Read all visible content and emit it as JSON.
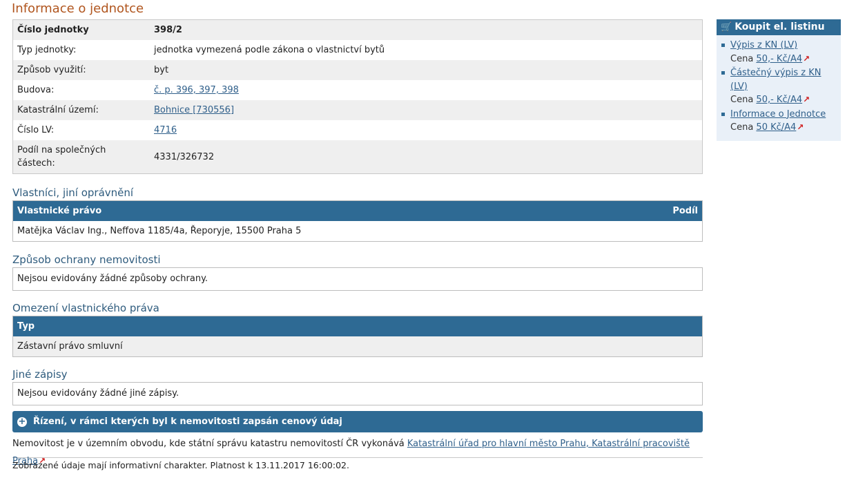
{
  "page_title": "Informace o jednotce",
  "unit_info": {
    "rows": [
      {
        "label": "Číslo jednotky",
        "value": "398/2"
      },
      {
        "label": "Typ jednotky:",
        "value": "jednotka vymezená podle zákona o vlastnictví bytů"
      },
      {
        "label": "Způsob využití:",
        "value": "byt"
      },
      {
        "label": "Budova:",
        "value": "č. p. 396, 397, 398"
      },
      {
        "label": "Katastrální území:",
        "value": "Bohnice [730556]"
      },
      {
        "label": "Číslo LV:",
        "value": "4716"
      },
      {
        "label": "Podíl na společných částech:",
        "value": "4331/326732"
      }
    ]
  },
  "owners": {
    "title": "Vlastníci, jiní oprávnění",
    "col_right": "Vlastnické právo",
    "col_share": "Podíl",
    "rows": [
      "Matějka Václav Ing., Neffova 1185/4a, Řeporyje, 15500 Praha 5"
    ]
  },
  "protection": {
    "title": "Způsob ochrany nemovitosti",
    "text": "Nejsou evidovány žádné způsoby ochrany."
  },
  "restrictions": {
    "title": "Omezení vlastnického práva",
    "col_type": "Typ",
    "rows": [
      "Zástavní právo smluvní"
    ]
  },
  "other_records": {
    "title": "Jiné zápisy",
    "text": "Nejsou evidovány žádné jiné zápisy."
  },
  "proceedings_bar": "Řízení, v rámci kterých byl k nemovitosti zapsán cenový údaj",
  "office": {
    "text": "Nemovitost je v územním obvodu, kde státní správu katastru nemovitostí ČR vykonává",
    "link": "Katastrální úřad pro hlavní město Prahu, Katastrální pracoviště Praha"
  },
  "disclaimer": "Zobrazené údaje mají informativní charakter. Platnost k 13.11.2017 16:00:02.",
  "sidebar": {
    "title": "Koupit el. listinu",
    "items": [
      {
        "link": "Výpis z KN (LV)",
        "price_label": "Cena",
        "price": "50,- Kč/A4"
      },
      {
        "link": "Částečný výpis z KN (LV)",
        "price_label": "Cena",
        "price": "50,- Kč/A4"
      },
      {
        "link": "Informace o Jednotce",
        "price_label": "Cena",
        "price": "50 Kč/A4"
      }
    ]
  },
  "colors": {
    "header_blue": "#2e6a94",
    "title_orange": "#b0551e",
    "ext_link_red": "#d02020"
  }
}
